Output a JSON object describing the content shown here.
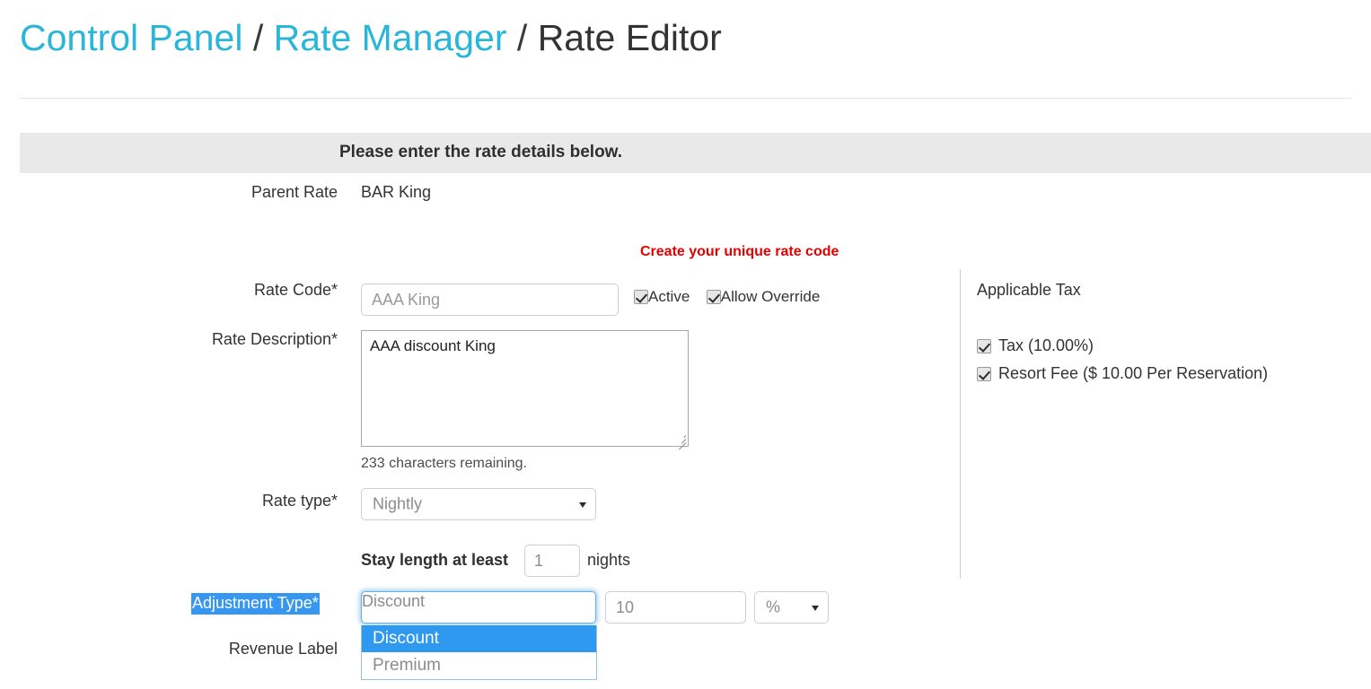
{
  "breadcrumb": {
    "root": "Control Panel",
    "sep1": "/",
    "section": "Rate Manager",
    "sep2": "/",
    "current": "Rate Editor"
  },
  "instruction": "Please enter the rate details below.",
  "form": {
    "parent_rate_label": "Parent Rate",
    "parent_rate_value": "BAR King",
    "hint_rate_code": "Create your unique rate code",
    "rate_code_label": "Rate Code*",
    "rate_code_value": "AAA King",
    "rate_code_placeholder": "AAA King",
    "checkboxes": [
      {
        "label": "Active",
        "checked": true
      },
      {
        "label": "Allow Override",
        "checked": true
      }
    ],
    "rate_description_label": "Rate Description*",
    "rate_description_value": "AAA discount King",
    "characters_remaining": "233 characters remaining.",
    "rate_type_label": "Rate type*",
    "rate_type_value": "Nightly",
    "stay_length_label": "Stay length at least",
    "stay_length_value": "1",
    "stay_length_suffix": "nights",
    "adjustment_type_label": "Adjustment Type*",
    "adjustment_type_value": "Discount",
    "adjustment_amount_value": "10",
    "adjustment_unit_value": "%",
    "adjustment_options": [
      {
        "label": "Discount",
        "selected": true
      },
      {
        "label": "Premium",
        "selected": false
      }
    ],
    "revenue_label_label": "Revenue Label"
  },
  "tax_panel": {
    "title": "Applicable Tax",
    "items": [
      {
        "label": "Tax (10.00%)",
        "checked": true
      },
      {
        "label": "Resort Fee ($ 10.00 Per Reservation)",
        "checked": true
      }
    ]
  },
  "colors": {
    "link": "#29b6d8",
    "hint_red": "#e60000",
    "highlight_blue": "#2f99f0",
    "bar_grey": "#e9e9e9"
  }
}
